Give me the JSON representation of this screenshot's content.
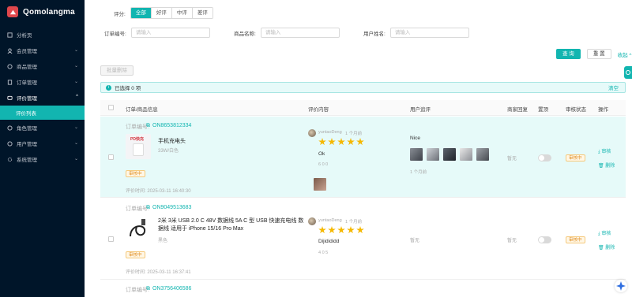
{
  "app": {
    "title": "Qomolangma"
  },
  "sidebar": {
    "items": [
      {
        "label": "分析页"
      },
      {
        "label": "会员管理"
      },
      {
        "label": "商品管理"
      },
      {
        "label": "订单管理"
      },
      {
        "label": "评价管理"
      },
      {
        "label": "评价列表"
      },
      {
        "label": "角色管理"
      },
      {
        "label": "用户管理"
      },
      {
        "label": "系统管理"
      }
    ]
  },
  "filters": {
    "rating_label": "评分:",
    "rating_options": [
      "全部",
      "好评",
      "中评",
      "差评"
    ],
    "rating_selected": "全部",
    "order_no_label": "订单编号:",
    "order_no_placeholder": "请输入",
    "product_name_label": "商品名称:",
    "product_name_placeholder": "请输入",
    "user_name_label": "用户姓名:",
    "user_name_placeholder": "请输入",
    "search_button": "查 询",
    "reset_button": "重 置",
    "collapse_link": "收起 ^"
  },
  "toolbar": {
    "batch_delete": "批量删除"
  },
  "selection": {
    "text": "已选择 0 项",
    "clear": "清空"
  },
  "table": {
    "headers": [
      "订单/商品信息",
      "评价内容",
      "用户追评",
      "商家回复",
      "置顶",
      "审核状态",
      "操作"
    ],
    "rows": [
      {
        "order_label": "订单编号:",
        "order_no": "ON8653812334",
        "product_name": "手机充电头",
        "product_spec": "33W/白色",
        "status_tag": "审核中",
        "eval_time": "评价时间: 2025-03-11 16:40:30",
        "user": "yuntaoDeng",
        "user_time": "1 个月前",
        "rating": 5,
        "comment": "Ok",
        "stats": "6 0 0",
        "followup": "Nice",
        "followup_time": "1 个月前",
        "reply": "暂无",
        "audit": "审核中",
        "op_audit": "审核",
        "op_delete": "删除"
      },
      {
        "order_label": "订单编号:",
        "order_no": "ON9049513683",
        "product_name": "2米 3米 USB 2.0 C 48V 数据线 5A C 型 USB 快速充电线 数据线 适用于 iPhone 15/16 Pro Max",
        "product_spec": "黑色",
        "status_tag": "审核中",
        "eval_time": "评价时间: 2025-03-11 16:37:41",
        "user": "yuntaoDeng",
        "user_time": "1 个月前",
        "rating": 5,
        "comment": "Dijidididd",
        "stats": "4 0 5",
        "followup": "暂无",
        "followup_time": "",
        "reply": "暂无",
        "audit": "审核中",
        "op_audit": "审核",
        "op_delete": "删除"
      },
      {
        "order_label": "订单编号:",
        "order_no": "ON3756406586"
      }
    ]
  },
  "colors": {
    "accent": "#12b5b0",
    "sidebar": "#001529",
    "star": "#f5b800"
  }
}
